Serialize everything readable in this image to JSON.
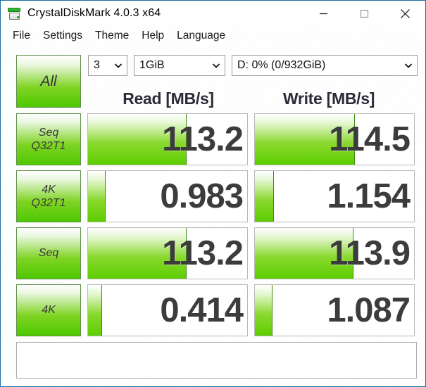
{
  "window": {
    "title": "CrystalDiskMark 4.0.3 x64",
    "icon": "disk-drive-icon",
    "border_color": "#1b6ea8",
    "controls": {
      "minimize": "minimize-icon",
      "maximize": "maximize-icon",
      "close": "close-icon"
    }
  },
  "menubar": {
    "items": [
      {
        "label": "File"
      },
      {
        "label": "Settings"
      },
      {
        "label": "Theme"
      },
      {
        "label": "Help"
      },
      {
        "label": "Language"
      }
    ]
  },
  "toolbar": {
    "all_button_label": "All",
    "runs_select": {
      "value": "3"
    },
    "size_select": {
      "value": "1GiB"
    },
    "drive_select": {
      "value": "D: 0% (0/932GiB)"
    },
    "chevron_icon": "chevron-down-icon"
  },
  "headers": {
    "read": "Read [MB/s]",
    "write": "Write [MB/s]"
  },
  "accent": {
    "green_dark": "#4ec800",
    "green_light": "#8ad92e",
    "button_border": "#5f8f4a",
    "text_dark": "#3c3c3c"
  },
  "results": {
    "rows": [
      {
        "label_line1": "Seq",
        "label_line2": "Q32T1",
        "read": "113.2",
        "write": "114.5",
        "read_bar_pct": 62,
        "write_bar_pct": 63
      },
      {
        "label_line1": "4K",
        "label_line2": "Q32T1",
        "read": "0.983",
        "write": "1.154",
        "read_bar_pct": 11,
        "write_bar_pct": 12
      },
      {
        "label_line1": "Seq",
        "label_line2": "",
        "read": "113.2",
        "write": "113.9",
        "read_bar_pct": 62,
        "write_bar_pct": 62
      },
      {
        "label_line1": "4K",
        "label_line2": "",
        "read": "0.414",
        "write": "1.087",
        "read_bar_pct": 9,
        "write_bar_pct": 11
      }
    ]
  },
  "status": {
    "text": ""
  }
}
